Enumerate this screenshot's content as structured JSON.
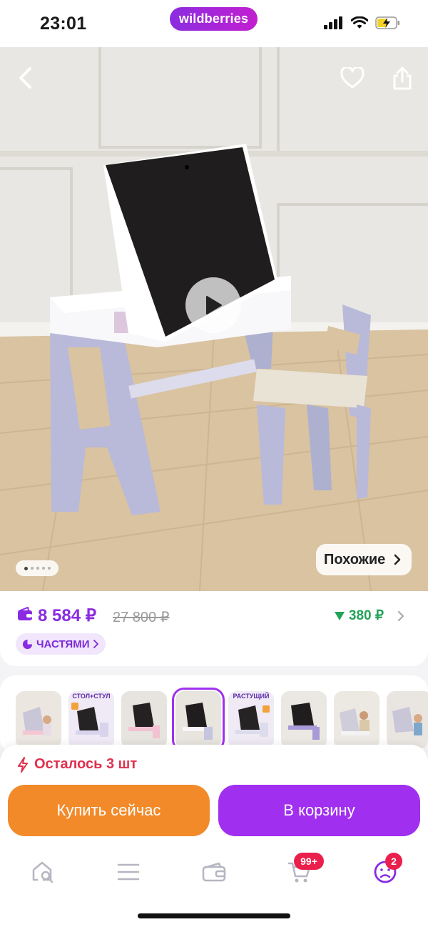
{
  "status_bar": {
    "time": "23:01",
    "brand": "wildberries"
  },
  "hero": {
    "back_icon": "chevron-left-icon",
    "favorite_icon": "heart-icon",
    "share_icon": "share-icon",
    "play_icon": "play-icon",
    "image_count": 5,
    "active_image_index": 0,
    "similar_label": "Похожие"
  },
  "price": {
    "current": "8 584 ₽",
    "old": "27 800 ₽",
    "cashback": "380 ₽",
    "installments_label": "ЧАСТЯМИ",
    "accent_color": "#8a2be2",
    "cashback_color": "#22a35a"
  },
  "thumbnails": [
    {
      "caption": ""
    },
    {
      "caption": "СТОЛ+СТУЛ"
    },
    {
      "caption": ""
    },
    {
      "caption": "",
      "selected": true
    },
    {
      "caption": "РАСТУЩИЙ"
    },
    {
      "caption": ""
    },
    {
      "caption": ""
    },
    {
      "caption": ""
    }
  ],
  "stock": {
    "label": "Осталось 3 шт",
    "color": "#e0304f"
  },
  "actions": {
    "buy_now": "Купить сейчас",
    "add_to_cart": "В корзину",
    "buy_color": "#f28a2a",
    "cart_color": "#a12ff0"
  },
  "tabbar": {
    "items": [
      {
        "icon": "home-search-icon"
      },
      {
        "icon": "menu-icon"
      },
      {
        "icon": "wallet-icon"
      },
      {
        "icon": "cart-icon",
        "badge": "99+"
      },
      {
        "icon": "profile-icon",
        "badge": "2"
      }
    ]
  }
}
